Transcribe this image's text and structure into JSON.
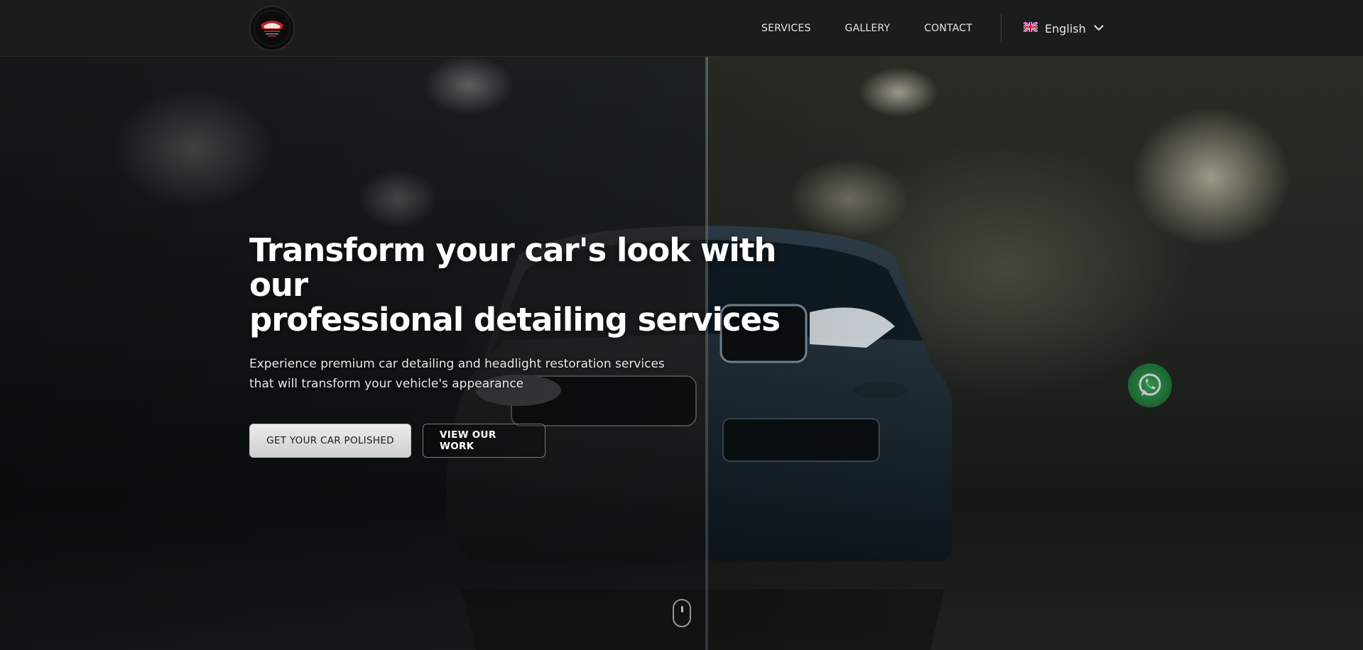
{
  "header": {
    "logo_name": "logo-icon",
    "nav": [
      {
        "label": "SERVICES"
      },
      {
        "label": "GALLERY"
      },
      {
        "label": "CONTACT"
      }
    ],
    "language": {
      "flag_icon": "uk-flag-icon",
      "label": "English",
      "chevron_icon": "chevron-down-icon"
    }
  },
  "hero": {
    "title_line1": "Transform your car's look with our",
    "title_line2": "professional detailing services",
    "subtitle": "Experience premium car detailing and headlight restoration services that will transform your vehicle's appearance",
    "primary_cta": "GET YOUR CAR POLISHED",
    "secondary_cta": "VIEW OUR WORK"
  },
  "icons": {
    "scroll": "mouse-scroll-icon",
    "whatsapp": "whatsapp-icon"
  },
  "colors": {
    "header_bg": "#1b1c1c",
    "primary_button": "#dcdcdc",
    "whatsapp_green": "#25d366"
  }
}
